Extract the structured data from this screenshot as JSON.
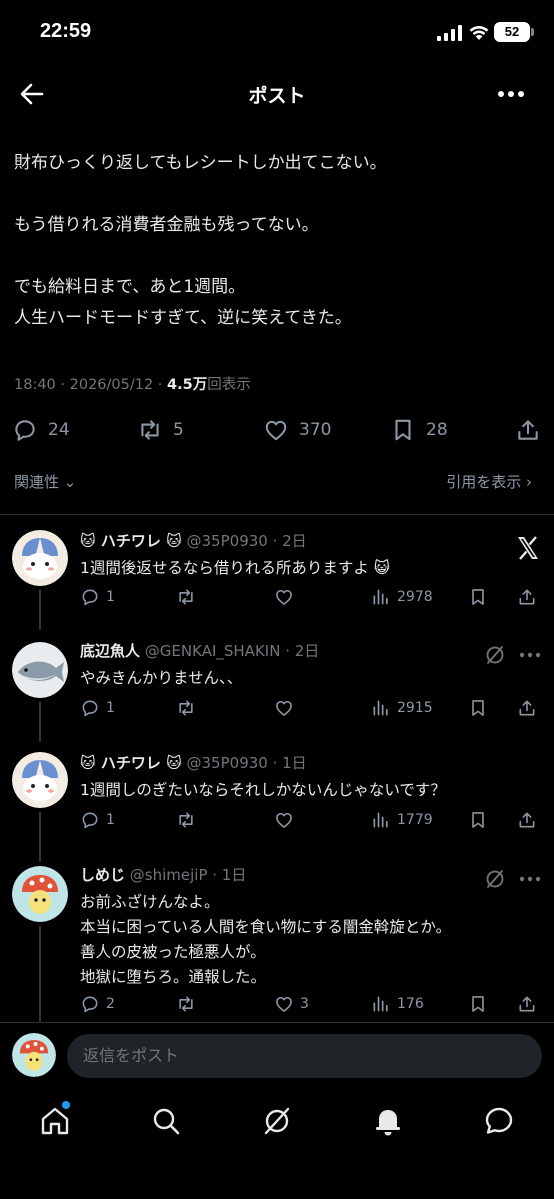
{
  "status_bar": {
    "time": "22:59",
    "battery": "52"
  },
  "header": {
    "title": "ポスト"
  },
  "post": {
    "text": "財布ひっくり返してもレシートしか出てこない。\n\nもう借りれる消費者金融も残ってない。\n\nでも給料日まで、あと1週間。\n人生ハードモードすぎて、逆に笑えてきた。",
    "time": "18:40 · 2026/05/12 · ",
    "views": "4.5万",
    "views_suffix": "回表示",
    "replies": "24",
    "reposts": "5",
    "likes": "370",
    "bookmarks": "28"
  },
  "sort": {
    "label": "関連性",
    "quotes_link": "引用を表示"
  },
  "replies": [
    {
      "name": "🐱 ハチワレ 🐱",
      "handle": "@35P0930 · 2日",
      "text": "1週間後返せるなら借りれる所ありますよ 😺",
      "replies": "1",
      "likes": "",
      "views": "2978"
    },
    {
      "name": "底辺魚人",
      "handle": "@GENKAI_SHAKIN · 2日",
      "text": "やみきんかりません、、",
      "replies": "1",
      "likes": "",
      "views": "2915"
    },
    {
      "name": "🐱 ハチワレ 🐱",
      "handle": "@35P0930 · 1日",
      "text": "1週間しのぎたいならそれしかないんじゃないです？",
      "replies": "1",
      "likes": "",
      "views": "1779"
    },
    {
      "name": "しめじ",
      "handle": "@shimejiP · 1日",
      "text": "お前ふざけんなよ。\n本当に困っている人間を食い物にする闇金斡旋とか。\n善人の皮被った極悪人が。\n地獄に堕ちろ。通報した。",
      "replies": "2",
      "likes": "3",
      "views": "176"
    }
  ],
  "composer": {
    "placeholder": "返信をポスト"
  },
  "colors": {
    "background": "#000000",
    "text": "#e7e9ea",
    "muted": "#71767b",
    "accent": "#1d9bf0"
  },
  "icons": [
    "back-arrow-icon",
    "more-icon",
    "reply-icon",
    "repost-icon",
    "like-icon",
    "bookmark-icon",
    "share-icon",
    "views-icon",
    "x-logo-icon",
    "grok-icon",
    "home-icon",
    "search-icon",
    "notifications-icon",
    "messages-icon"
  ]
}
